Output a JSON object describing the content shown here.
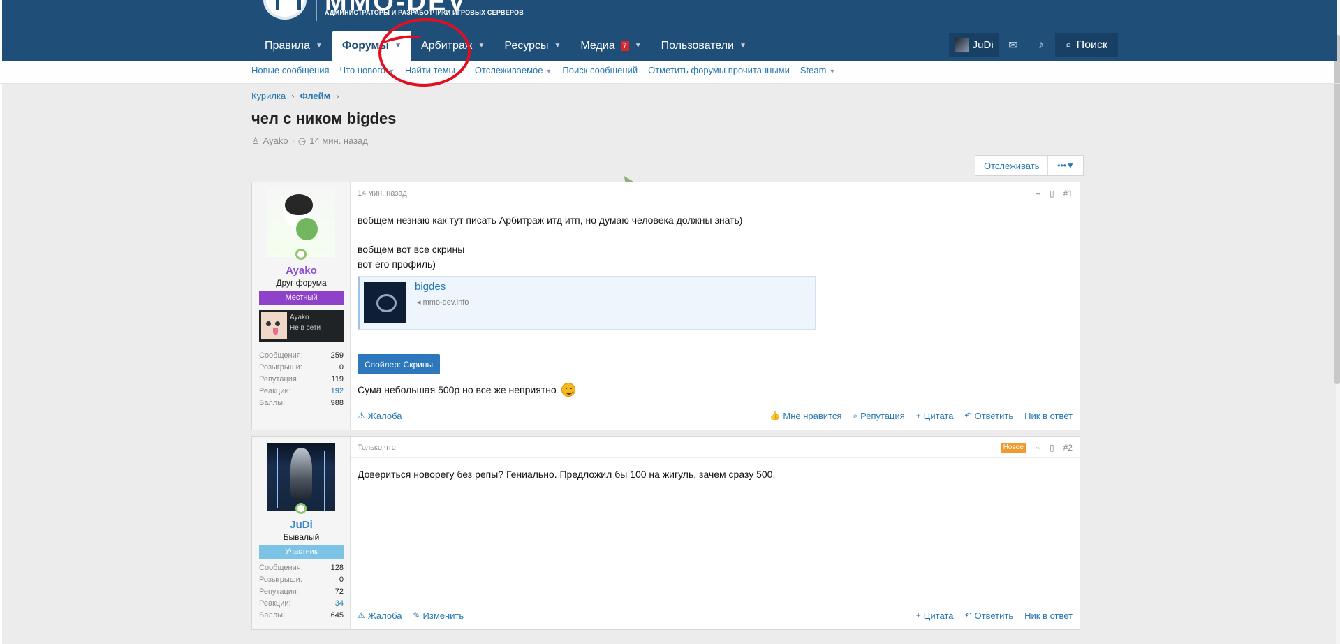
{
  "logo": {
    "title": "MMO-DEV",
    "subtitle": "АДМИНИСТРАТОРЫ И РАЗРАБОТЧИКИ ИГРОВЫХ СЕРВЕРОВ"
  },
  "nav": {
    "items": [
      {
        "label": "Правила"
      },
      {
        "label": "Форумы"
      },
      {
        "label": "Арбитраж"
      },
      {
        "label": "Ресурсы"
      },
      {
        "label": "Медиа",
        "badge": "7"
      },
      {
        "label": "Пользователи"
      }
    ],
    "user": "JuDi",
    "search": "Поиск"
  },
  "subnav": {
    "items": [
      {
        "label": "Новые сообщения"
      },
      {
        "label": "Что нового"
      },
      {
        "label": "Найти темы"
      },
      {
        "label": "Отслеживаемое"
      },
      {
        "label": "Поиск сообщений"
      },
      {
        "label": "Отметить форумы прочитанными"
      },
      {
        "label": "Steam"
      }
    ]
  },
  "breadcrumb": {
    "items": [
      "Курилка",
      "Флейм"
    ]
  },
  "thread": {
    "title": "чел с ником bigdes",
    "author": "Ayako",
    "time": "14 мин. назад",
    "follow": "Отслеживать"
  },
  "posts": [
    {
      "author": "Ayako",
      "rank": "Друг форума",
      "banner": "Местный",
      "steam_name": "Ayako",
      "steam_status": "Не в сети",
      "stats": [
        {
          "label": "Сообщения:",
          "value": "259"
        },
        {
          "label": "Розыгрыши:",
          "value": "0"
        },
        {
          "label": "Репутация :",
          "value": "119"
        },
        {
          "label": "Реакции:",
          "value": "192"
        },
        {
          "label": "Баллы:",
          "value": "988"
        }
      ],
      "time": "14 мин. назад",
      "number": "#1",
      "lines": [
        "вобщем незнаю как тут писать Арбитраж итд итп, но думаю человека должны знать)",
        "вобщем вот все скрины",
        "вот его профиль)"
      ],
      "embed": {
        "title": "bigdes",
        "url": "mmo-dev.info"
      },
      "spoiler": "Спойлер: Скрины",
      "final_line": "Сума небольшая 500р но все же неприятно",
      "actions_left": [
        {
          "label": "Жалоба"
        }
      ],
      "actions_right": [
        {
          "label": "Мне нравится"
        },
        {
          "label": "Репутация"
        },
        {
          "label": "Цитата"
        },
        {
          "label": "Ответить"
        },
        {
          "label": "Ник в ответ"
        }
      ]
    },
    {
      "author": "JuDi",
      "rank": "Бывалый",
      "banner": "Участник",
      "stats": [
        {
          "label": "Сообщения:",
          "value": "128"
        },
        {
          "label": "Розыгрыши:",
          "value": "0"
        },
        {
          "label": "Репутация :",
          "value": "72"
        },
        {
          "label": "Реакции:",
          "value": "34"
        },
        {
          "label": "Баллы:",
          "value": "645"
        }
      ],
      "time": "Только что",
      "new_label": "Новое",
      "number": "#2",
      "text": "Довериться новорегу без репы? Гениально. Предложил бы 100 на жигуль, зачем сразу 500.",
      "actions_left": [
        {
          "label": "Жалоба"
        },
        {
          "label": "Изменить"
        }
      ],
      "actions_right": [
        {
          "label": "Цитата"
        },
        {
          "label": "Ответить"
        },
        {
          "label": "Ник в ответ"
        }
      ]
    }
  ]
}
